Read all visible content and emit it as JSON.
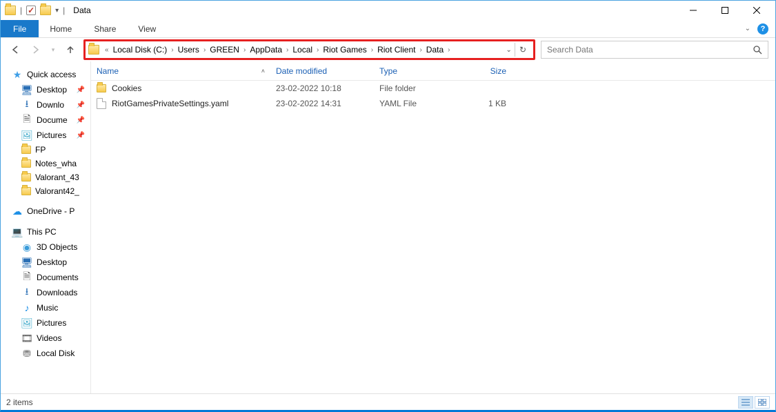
{
  "window": {
    "title": "Data"
  },
  "ribbon": {
    "file": "File",
    "home": "Home",
    "share": "Share",
    "view": "View"
  },
  "breadcrumbs": [
    "Local Disk (C:)",
    "Users",
    "GREEN",
    "AppData",
    "Local",
    "Riot Games",
    "Riot Client",
    "Data"
  ],
  "search": {
    "placeholder": "Search Data"
  },
  "columns": {
    "name": "Name",
    "date": "Date modified",
    "type": "Type",
    "size": "Size"
  },
  "files": [
    {
      "name": "Cookies",
      "date": "23-02-2022 10:18",
      "type": "File folder",
      "size": "",
      "kind": "folder"
    },
    {
      "name": "RiotGamesPrivateSettings.yaml",
      "date": "23-02-2022 14:31",
      "type": "YAML File",
      "size": "1 KB",
      "kind": "file"
    }
  ],
  "sidebar": {
    "quick_access": "Quick access",
    "desktop": "Desktop",
    "downloads": "Downlo",
    "documents": "Docume",
    "pictures": "Pictures",
    "fp": "FP",
    "notes": "Notes_wha",
    "val43": "Valorant_43",
    "val42": "Valorant42_",
    "onedrive": "OneDrive - P",
    "this_pc": "This PC",
    "objects3d": "3D Objects",
    "desktop2": "Desktop",
    "documents2": "Documents",
    "downloads2": "Downloads",
    "music": "Music",
    "pictures2": "Pictures",
    "videos": "Videos",
    "localdisk": "Local Disk"
  },
  "status": {
    "items": "2 items"
  }
}
